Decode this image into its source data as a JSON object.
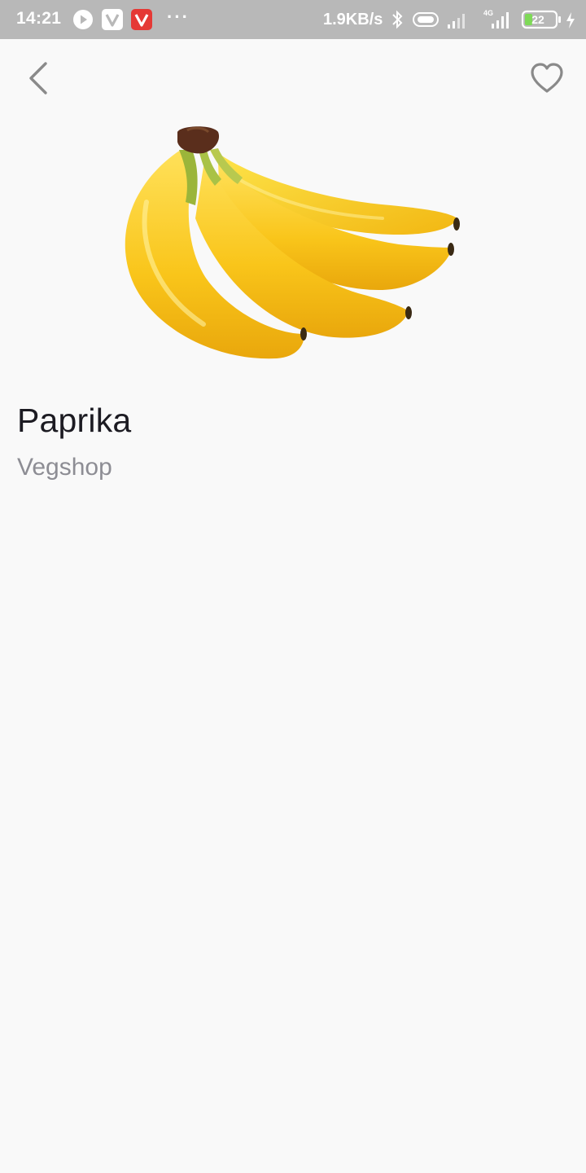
{
  "status_bar": {
    "time": "14:21",
    "network_speed": "1.9KB/s",
    "battery_level": "22",
    "app_icons": [
      "play-store-icon",
      "v-app-icon",
      "vivaldi-icon"
    ],
    "overflow": "···",
    "network_type": "4G"
  },
  "product": {
    "name": "Paprika",
    "vendor": "Vegshop"
  },
  "colors": {
    "status_bar": "#b8b8b8",
    "background": "#f9f9f9",
    "title": "#1c1b22",
    "subtitle": "#8d8d94",
    "icon": "#8a8a8a"
  }
}
